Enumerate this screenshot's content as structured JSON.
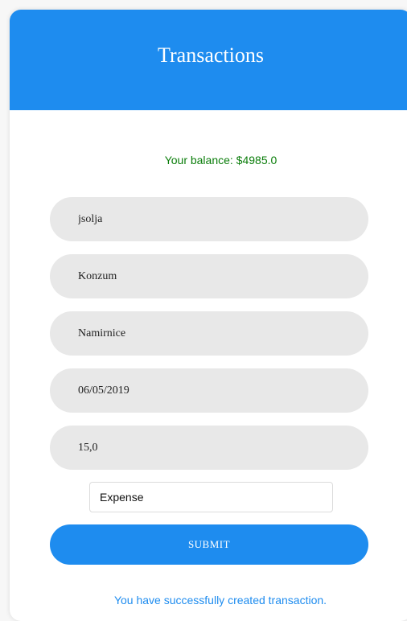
{
  "header": {
    "title": "Transactions"
  },
  "balance_text": "Your balance: $4985.0",
  "form": {
    "username": "jsolja",
    "merchant": "Konzum",
    "category": "Namirnice",
    "date": "06/05/2019",
    "amount": "15,0",
    "type_selected": "Expense",
    "submit_label": "SUBMIT"
  },
  "success_message": "You have successfully created transaction.",
  "colors": {
    "accent": "#1e8cef",
    "balance": "#0a7d0a",
    "field_bg": "#e8e8e8"
  }
}
